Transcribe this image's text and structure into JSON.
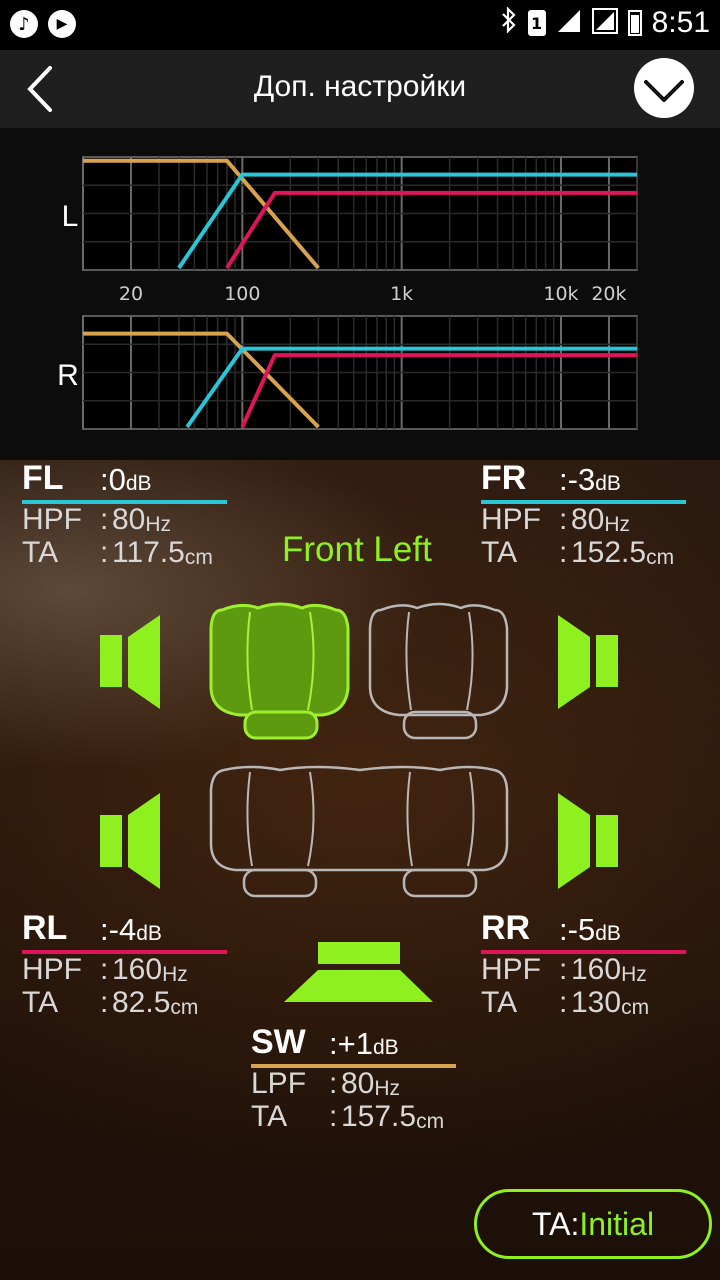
{
  "status_bar": {
    "time": "8:51",
    "sim": "1",
    "left_icons": [
      "music-note-icon",
      "play-icon"
    ],
    "right_icons": [
      "bluetooth-icon",
      "sim-icon",
      "signal-icon",
      "signal-icon",
      "battery-icon"
    ]
  },
  "header": {
    "title": "Доп. настройки",
    "back_icon": "chevron-left-icon",
    "confirm_icon": "checkmark-circle-icon"
  },
  "chart_data": [
    {
      "type": "line",
      "title": "L",
      "xscale": "log",
      "xlim": [
        10,
        30000
      ],
      "x_tick_labels": [
        "20",
        "100",
        "1k",
        "10k",
        "20k"
      ],
      "x_ticks": [
        20,
        100,
        1000,
        10000,
        20000
      ],
      "series": [
        {
          "color": "#d9a24c",
          "points": [
            [
              10,
              1.0
            ],
            [
              80,
              1.0
            ],
            [
              300,
              0.0
            ]
          ]
        },
        {
          "color": "#29c6d8",
          "points": [
            [
              40,
              0.0
            ],
            [
              100,
              0.87
            ],
            [
              30000,
              0.87
            ]
          ]
        },
        {
          "color": "#e0145a",
          "points": [
            [
              80,
              0.0
            ],
            [
              160,
              0.7
            ],
            [
              30000,
              0.7
            ]
          ]
        }
      ]
    },
    {
      "type": "line",
      "title": "R",
      "xscale": "log",
      "xlim": [
        10,
        30000
      ],
      "x_tick_labels": [
        "20",
        "100",
        "1k",
        "10k",
        "20k"
      ],
      "x_ticks": [
        20,
        100,
        1000,
        10000,
        20000
      ],
      "series": [
        {
          "color": "#d9a24c",
          "points": [
            [
              10,
              0.87
            ],
            [
              80,
              0.87
            ],
            [
              300,
              0.0
            ]
          ]
        },
        {
          "color": "#29c6d8",
          "points": [
            [
              45,
              0.0
            ],
            [
              100,
              0.73
            ],
            [
              30000,
              0.73
            ]
          ]
        },
        {
          "color": "#e0145a",
          "points": [
            [
              100,
              0.0
            ],
            [
              160,
              0.67
            ],
            [
              30000,
              0.67
            ]
          ]
        }
      ]
    }
  ],
  "channels": {
    "fl": {
      "name": "FL",
      "gain": "0",
      "gain_unit": "dB",
      "filter_label": "HPF",
      "filter_value": "80",
      "filter_unit": "Hz",
      "ta_label": "TA",
      "ta_value": "117.5",
      "ta_unit": "cm",
      "color": "#29c6d8"
    },
    "fr": {
      "name": "FR",
      "gain": "-3",
      "gain_unit": "dB",
      "filter_label": "HPF",
      "filter_value": "80",
      "filter_unit": "Hz",
      "ta_label": "TA",
      "ta_value": "152.5",
      "ta_unit": "cm",
      "color": "#29c6d8"
    },
    "rl": {
      "name": "RL",
      "gain": "-4",
      "gain_unit": "dB",
      "filter_label": "HPF",
      "filter_value": "160",
      "filter_unit": "Hz",
      "ta_label": "TA",
      "ta_value": "82.5",
      "ta_unit": "cm",
      "color": "#e0145a"
    },
    "rr": {
      "name": "RR",
      "gain": "-5",
      "gain_unit": "dB",
      "filter_label": "HPF",
      "filter_value": "160",
      "filter_unit": "Hz",
      "ta_label": "TA",
      "ta_value": "130",
      "ta_unit": "cm",
      "color": "#e0145a"
    },
    "sw": {
      "name": "SW",
      "gain": "+1",
      "gain_unit": "dB",
      "filter_label": "LPF",
      "filter_value": "80",
      "filter_unit": "Hz",
      "ta_label": "TA",
      "ta_value": "157.5",
      "ta_unit": "cm",
      "color": "#d9a24c"
    }
  },
  "separator": ":",
  "selected_position": "Front Left",
  "ta_button": {
    "prefix": "TA:",
    "value": "Initial"
  },
  "colors": {
    "accent": "#8ef01e",
    "seat_outline": "#b8b8b8",
    "seat_selected_fill": "#5e9a10"
  }
}
